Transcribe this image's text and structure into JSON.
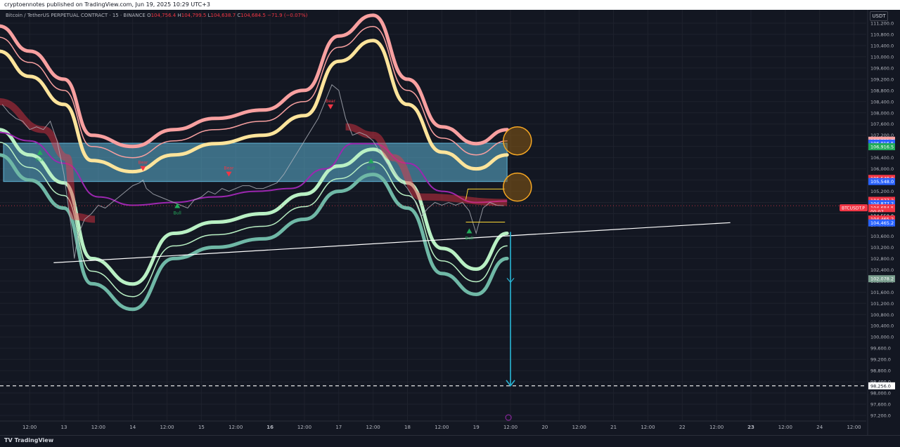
{
  "header": {
    "publish_line": "cryptoennotes published on TradingView.com, Jun 19, 2025 10:29 UTC+3"
  },
  "legend": {
    "symbol": "Bitcoin / TetherUS PERPETUAL CONTRACT · 15 · BINANCE",
    "open_label": "O",
    "open": "104,756.4",
    "high_label": "H",
    "high": "104,799.5",
    "low_label": "L",
    "low": "104,638.7",
    "close_label": "C",
    "close": "104,684.5",
    "change": "−71.9 (−0.07%)"
  },
  "currency": "USDT",
  "footer": {
    "brand": "TradingView"
  },
  "colors": {
    "background": "#131722",
    "bear": "#f23645",
    "bull": "#26a69a",
    "zone": "#5fb4d6",
    "ma": "#9c27b0",
    "upper_outer": "#f8a0a0",
    "upper_inner": "#fde49b",
    "lower_outer": "#6fb8a6",
    "lower_inner": "#b9f0c4",
    "circle": "#f5a623",
    "target_arrow": "#29b6d6"
  },
  "chart_data": {
    "type": "line",
    "title": "Bitcoin / TetherUS PERPETUAL CONTRACT · 15 · BINANCE",
    "ylabel": "USDT",
    "ylim": [
      97000,
      111400
    ],
    "y_ticks": [
      111200,
      110800,
      110400,
      110000,
      109600,
      109200,
      108800,
      108400,
      108000,
      107600,
      107200,
      106800,
      106400,
      106000,
      105600,
      105200,
      104800,
      104400,
      104000,
      103600,
      103200,
      102800,
      102400,
      102000,
      101600,
      101200,
      100800,
      100400,
      100000,
      99600,
      99200,
      98800,
      98400,
      98000,
      97600,
      97200
    ],
    "x_ticks": [
      {
        "label": "12:00",
        "t": -0.5
      },
      {
        "label": "13",
        "t": 0
      },
      {
        "label": "12:00",
        "t": 0.5
      },
      {
        "label": "14",
        "t": 1
      },
      {
        "label": "12:00",
        "t": 1.5
      },
      {
        "label": "15",
        "t": 2
      },
      {
        "label": "12:00",
        "t": 2.5
      },
      {
        "label": "16",
        "t": 3
      },
      {
        "label": "12:00",
        "t": 3.5
      },
      {
        "label": "17",
        "t": 4
      },
      {
        "label": "12:00",
        "t": 4.5
      },
      {
        "label": "18",
        "t": 5
      },
      {
        "label": "12:00",
        "t": 5.5
      },
      {
        "label": "19",
        "t": 6
      },
      {
        "label": "12:00",
        "t": 6.5
      },
      {
        "label": "20",
        "t": 7
      },
      {
        "label": "12:00",
        "t": 7.5
      },
      {
        "label": "21",
        "t": 8
      },
      {
        "label": "12:00",
        "t": 8.5
      },
      {
        "label": "22",
        "t": 9
      },
      {
        "label": "12:00",
        "t": 9.5
      },
      {
        "label": "23",
        "t": 10
      },
      {
        "label": "12:00",
        "t": 10.5
      },
      {
        "label": "24",
        "t": 11
      },
      {
        "label": "12:00",
        "t": 11.5
      }
    ],
    "bold_ticks": [
      "16",
      "23"
    ],
    "price_series": {
      "name": "BTCUSDT.P",
      "x": [
        -0.9,
        -0.8,
        -0.7,
        -0.6,
        -0.5,
        -0.4,
        -0.3,
        -0.2,
        -0.1,
        0,
        0.1,
        0.15,
        0.2,
        0.3,
        0.4,
        0.5,
        0.6,
        0.7,
        0.8,
        0.9,
        1.0,
        1.1,
        1.15,
        1.2,
        1.3,
        1.4,
        1.5,
        1.6,
        1.7,
        1.8,
        1.9,
        2.0,
        2.1,
        2.2,
        2.3,
        2.4,
        2.5,
        2.6,
        2.7,
        2.8,
        2.9,
        3.0,
        3.1,
        3.2,
        3.3,
        3.4,
        3.5,
        3.6,
        3.7,
        3.8,
        3.9,
        4.0,
        4.1,
        4.2,
        4.3,
        4.4,
        4.5,
        4.6,
        4.7,
        4.8,
        4.9,
        5.0,
        5.1,
        5.2,
        5.3,
        5.4,
        5.5,
        5.6,
        5.7,
        5.8,
        5.9,
        6.0,
        6.1,
        6.2,
        6.3,
        6.4
      ],
      "y": [
        108300,
        108000,
        107800,
        107700,
        107400,
        107500,
        107400,
        107700,
        107000,
        105800,
        104000,
        102800,
        103600,
        104200,
        104400,
        104700,
        104600,
        104800,
        105000,
        105200,
        105400,
        105500,
        105600,
        105300,
        105100,
        105000,
        104900,
        104800,
        104700,
        104600,
        104900,
        105000,
        105200,
        105100,
        105300,
        105200,
        105300,
        105400,
        105400,
        105300,
        105300,
        105400,
        105500,
        105800,
        106200,
        106600,
        107000,
        107400,
        107800,
        108400,
        109000,
        108800,
        107800,
        107200,
        107300,
        107200,
        107000,
        106600,
        106200,
        105900,
        105600,
        105300,
        104900,
        104300,
        104600,
        104800,
        104700,
        104800,
        104700,
        104800,
        104500,
        103700,
        104600,
        104800,
        104700,
        104685
      ]
    },
    "zone": {
      "low": 105548,
      "high": 106916
    },
    "trendline": {
      "x": [
        -0.15,
        9.7
      ],
      "y": [
        102650,
        104080
      ]
    },
    "target_level": 98256,
    "target_arrow": {
      "x": 6.5,
      "from": 103750,
      "to": 98256
    },
    "circles": [
      {
        "x": 6.6,
        "y": 107000
      },
      {
        "x": 6.6,
        "y": 105350
      }
    ],
    "signals": [
      {
        "label": "Bull",
        "x": -0.35,
        "y": 106500,
        "dir": "up"
      },
      {
        "label": "Bear",
        "x": 1.15,
        "y": 106100,
        "dir": "down"
      },
      {
        "label": "Bull",
        "x": 1.65,
        "y": 104600,
        "dir": "up"
      },
      {
        "label": "Bear",
        "x": 2.4,
        "y": 105900,
        "dir": "down"
      },
      {
        "label": "Bear",
        "x": 3.88,
        "y": 108300,
        "dir": "down"
      },
      {
        "label": "Bull",
        "x": 4.47,
        "y": 106200,
        "dir": "up"
      },
      {
        "label": "Bull",
        "x": 5.9,
        "y": 103700,
        "dir": "up"
      }
    ],
    "price_labels": [
      {
        "text": "107,021.7",
        "y": 107021.7,
        "color": "#f8a0a0"
      },
      {
        "text": "106,916.5",
        "y": 106916.5,
        "color": "#2962ff"
      },
      {
        "text": "106,916.5",
        "y": 106790,
        "color": "#22ab5a"
      },
      {
        "text": "105,548.0",
        "y": 105660,
        "color": "#f23645"
      },
      {
        "text": "105,548.0",
        "y": 105548,
        "color": "#2962ff"
      },
      {
        "text": "104,877.2",
        "y": 104877.2,
        "color": "#f23645"
      },
      {
        "text": "104,877.2",
        "y": 104760,
        "color": "#2962ff"
      },
      {
        "text": "104,684.5",
        "y": 104610,
        "color": "#f23645"
      },
      {
        "text": "00:07",
        "y": 104480,
        "color": "#f23645"
      },
      {
        "text": "104,550.0",
        "y": 104330,
        "color": "#131722"
      },
      {
        "text": "104,465.2",
        "y": 104210,
        "color": "#f23645"
      },
      {
        "text": "104,465.2",
        "y": 104070,
        "color": "#2962ff"
      },
      {
        "text": "102,078.2",
        "y": 102078.2,
        "color": "#7a9e8e"
      },
      {
        "text": "98,256.0",
        "y": 98256,
        "color": "#ffffff"
      }
    ],
    "symbol_tag": {
      "text": "BTCUSDT.P",
      "y": 104610
    }
  }
}
